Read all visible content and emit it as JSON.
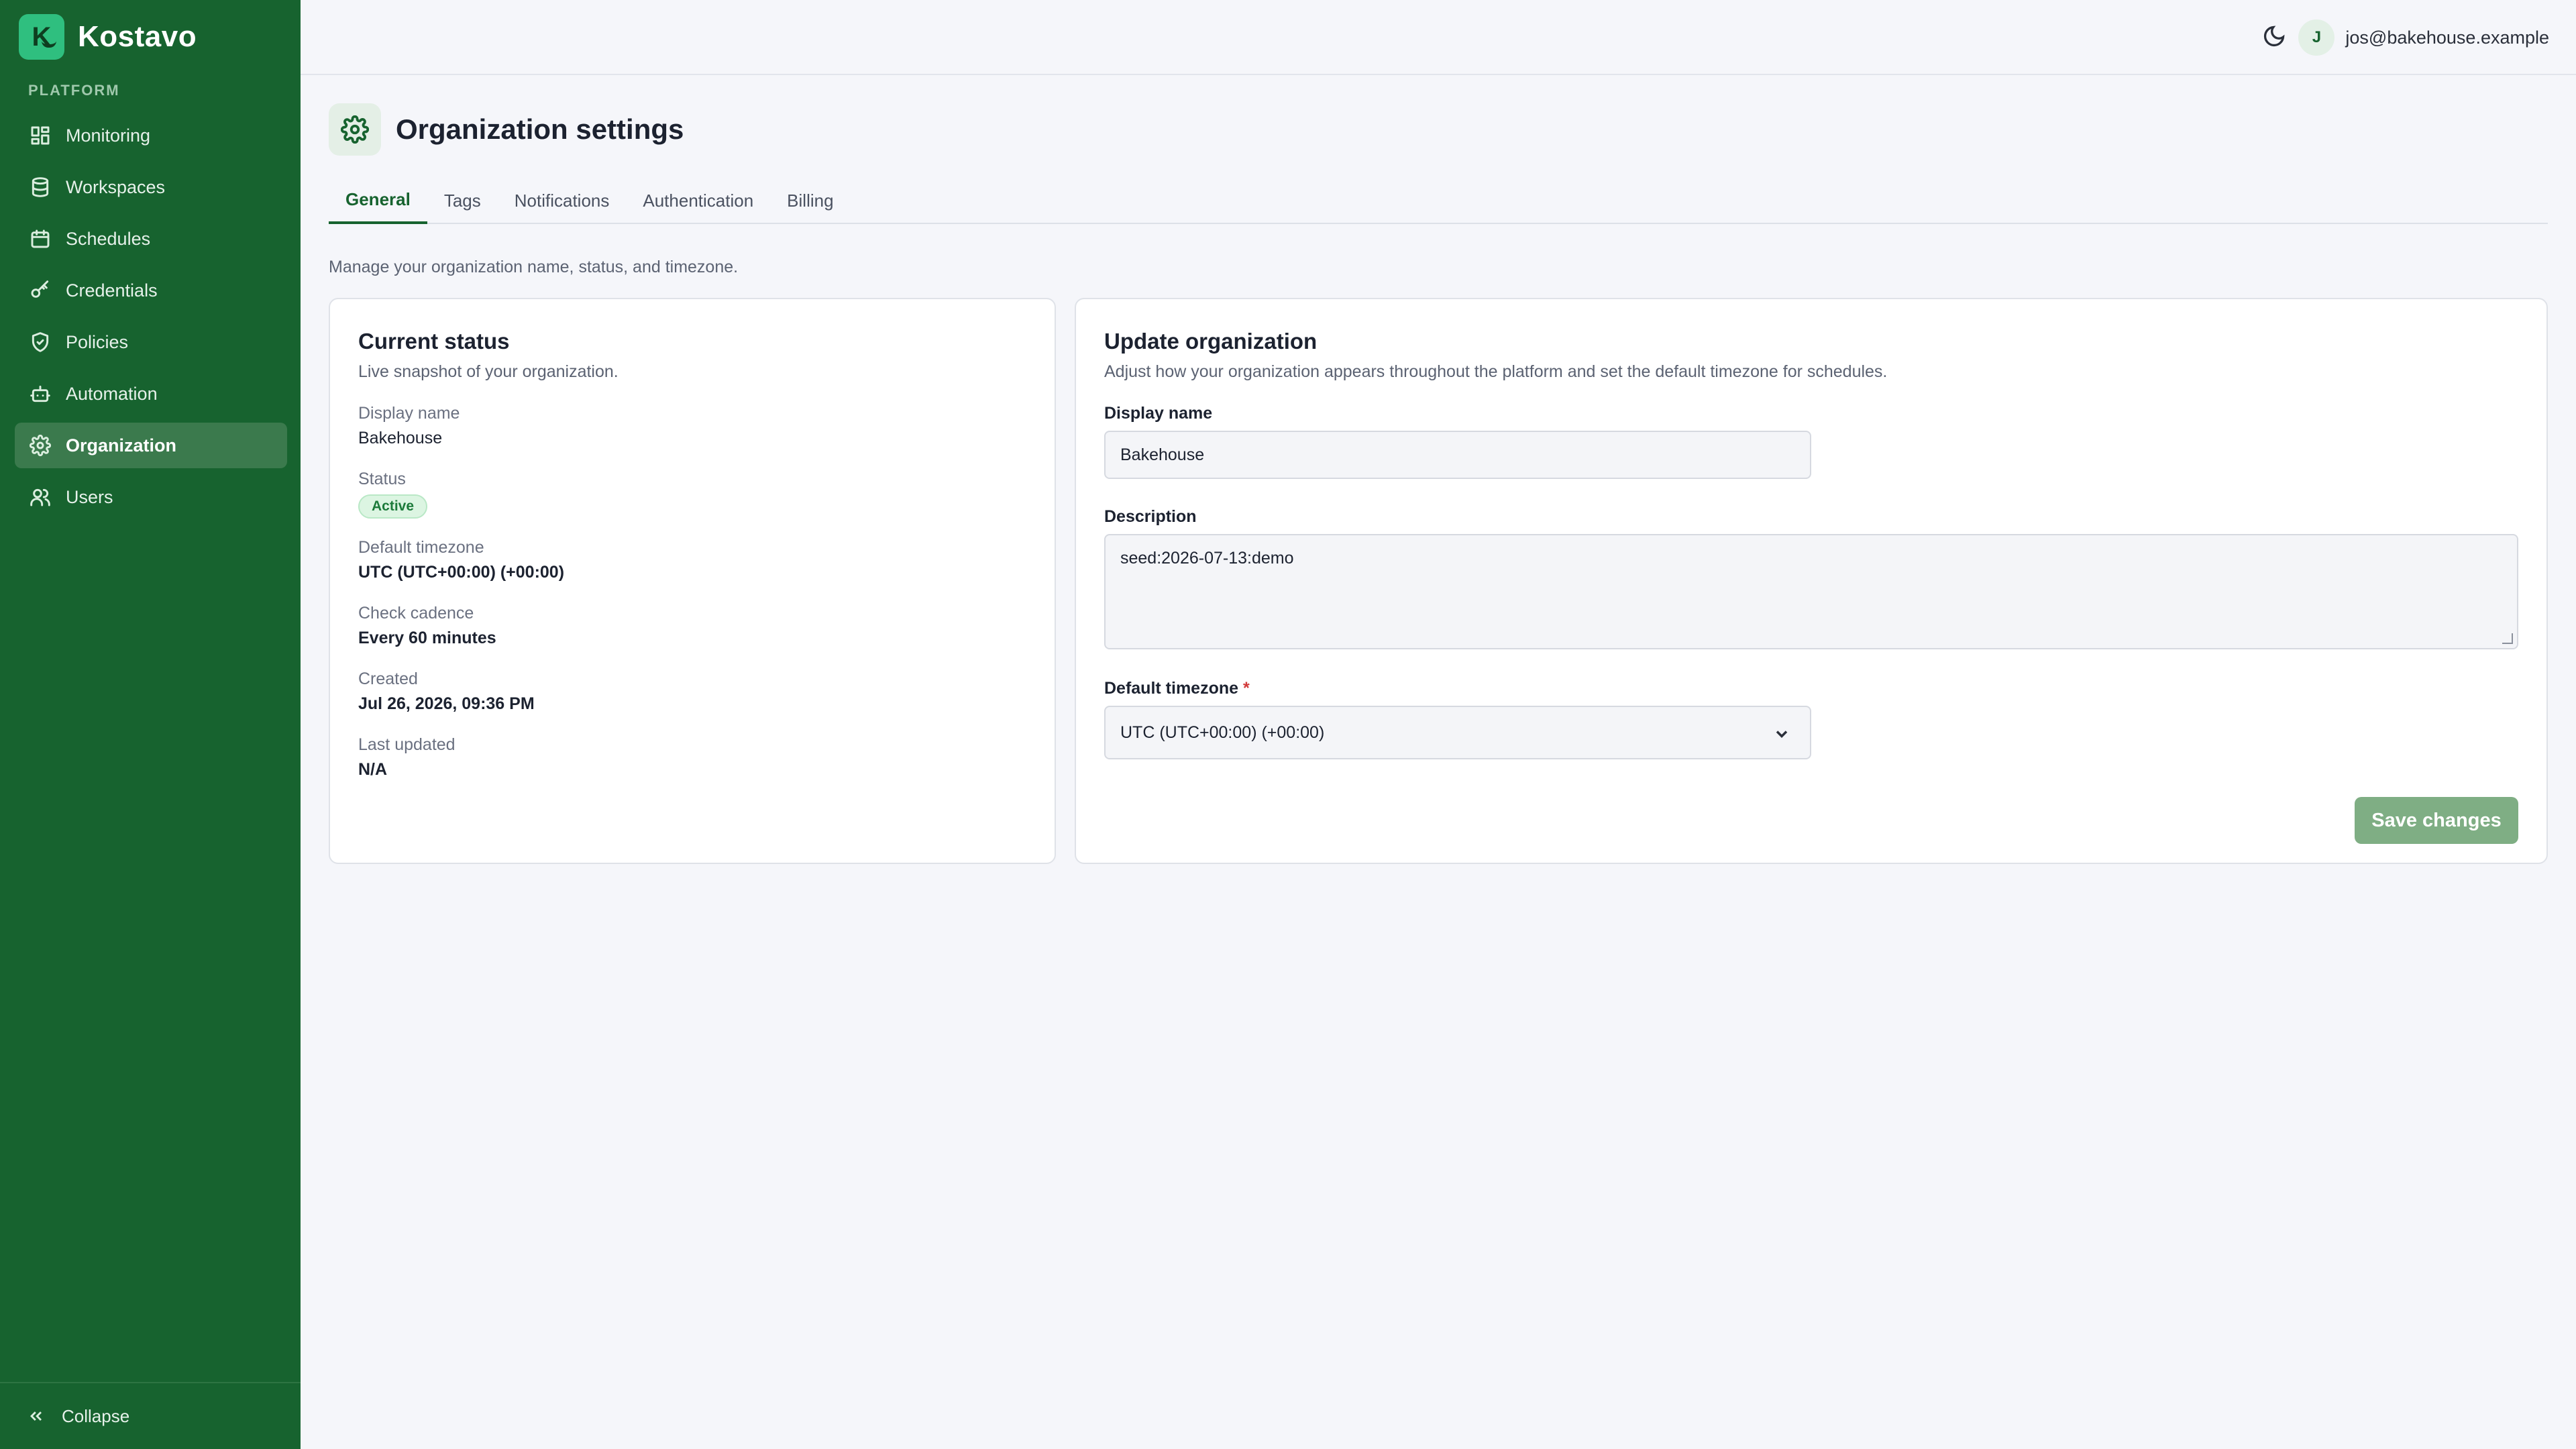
{
  "brand": {
    "logo_letter": "K",
    "name": "Kostavo"
  },
  "sidebar": {
    "section_label": "PLATFORM",
    "items": [
      {
        "label": "Monitoring",
        "icon": "dashboard-icon"
      },
      {
        "label": "Workspaces",
        "icon": "database-icon"
      },
      {
        "label": "Schedules",
        "icon": "calendar-icon"
      },
      {
        "label": "Credentials",
        "icon": "key-icon"
      },
      {
        "label": "Policies",
        "icon": "shield-icon"
      },
      {
        "label": "Automation",
        "icon": "robot-icon"
      },
      {
        "label": "Organization",
        "icon": "gear-icon",
        "active": true
      },
      {
        "label": "Users",
        "icon": "users-icon"
      }
    ],
    "collapse_label": "Collapse"
  },
  "topbar": {
    "theme_icon": "moon-icon",
    "user_initial": "J",
    "user_email": "jos@bakehouse.example"
  },
  "page": {
    "title": "Organization settings",
    "tabs": [
      "General",
      "Tags",
      "Notifications",
      "Authentication",
      "Billing"
    ],
    "active_tab": "General",
    "subtitle": "Manage your organization name, status, and timezone."
  },
  "status_card": {
    "title": "Current status",
    "description": "Live snapshot of your organization.",
    "fields": {
      "display_name_label": "Display name",
      "display_name_value": "Bakehouse",
      "status_label": "Status",
      "status_value": "Active",
      "timezone_label": "Default timezone",
      "timezone_value": "UTC (UTC+00:00) (+00:00)",
      "cadence_label": "Check cadence",
      "cadence_value": "Every 60 minutes",
      "created_label": "Created",
      "created_value": "Jul 26, 2026, 09:36 PM",
      "updated_label": "Last updated",
      "updated_value": "N/A"
    }
  },
  "update_card": {
    "title": "Update organization",
    "description": "Adjust how your organization appears throughout the platform and set the default timezone for schedules.",
    "display_name_label": "Display name",
    "display_name_value": "Bakehouse",
    "description_label": "Description",
    "description_value": "seed:2026-07-13:demo",
    "timezone_label": "Default timezone",
    "timezone_required": "*",
    "timezone_value": "UTC (UTC+00:00) (+00:00)",
    "save_label": "Save changes"
  },
  "colors": {
    "sidebar_bg": "#17632f",
    "accent": "#17632f",
    "save_button": "#7fae84",
    "active_badge_bg": "#dcf5e2"
  }
}
